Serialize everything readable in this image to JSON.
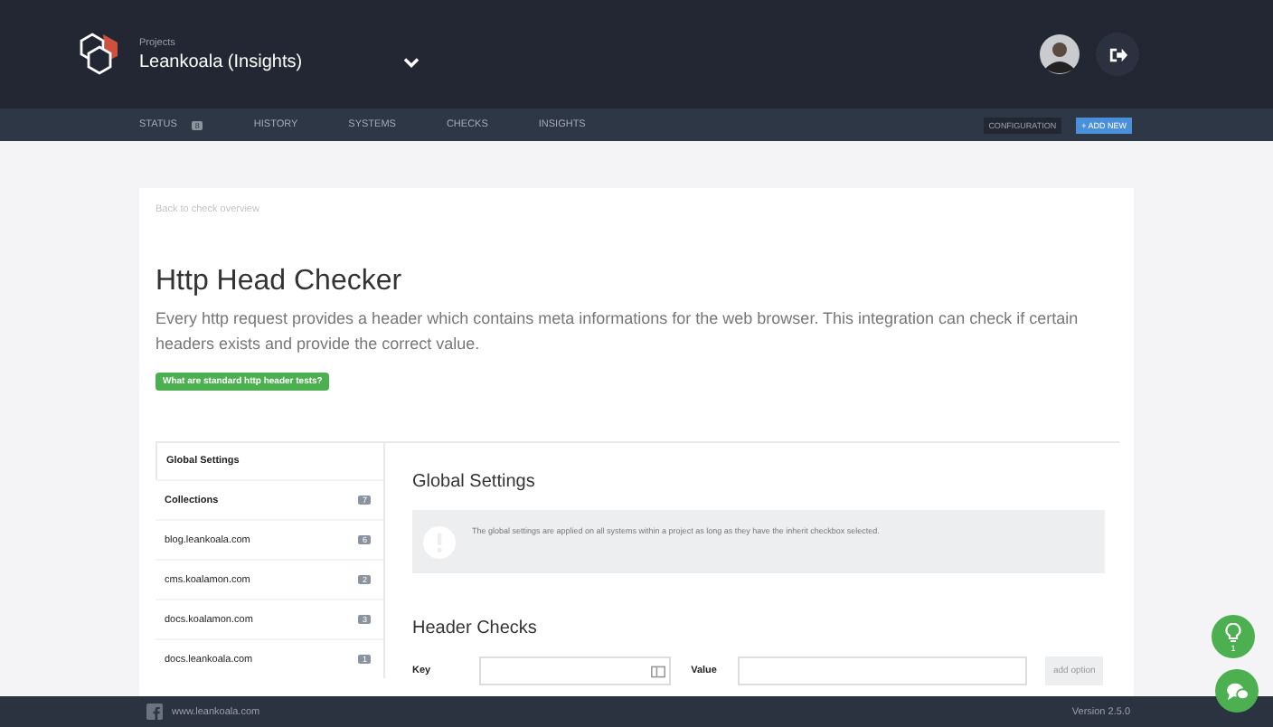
{
  "header": {
    "project_label": "Projects",
    "project_name": "Leankoala (Insights)"
  },
  "nav": {
    "items": [
      {
        "label": "STATUS",
        "badge": "8",
        "selected": false
      },
      {
        "label": "HISTORY",
        "selected": false
      },
      {
        "label": "SYSTEMS",
        "selected": false
      },
      {
        "label": "CHECKS",
        "selected": false
      },
      {
        "label": "INSIGHTS",
        "selected": false
      }
    ],
    "configuration": "CONFIGURATION",
    "add_new": "+ ADD NEW"
  },
  "back_link": "Back to check overview",
  "title": "Http Head Checker",
  "description": "Every http request provides a header which contains meta informations for the web browser. This integration can check if certain headers exists and provide the correct value.",
  "help_button": "What are standard http header tests?",
  "sidebar": {
    "tab": "Global Settings",
    "items": [
      {
        "label": "Collections",
        "badge": "7",
        "kind": "group"
      },
      {
        "label": "blog.leankoala.com",
        "badge": "6",
        "kind": "system"
      },
      {
        "label": "cms.koalamon.com",
        "badge": "2",
        "kind": "system"
      },
      {
        "label": "docs.koalamon.com",
        "badge": "3",
        "kind": "system"
      },
      {
        "label": "docs.leankoala.com",
        "badge": "1",
        "kind": "system"
      }
    ]
  },
  "settings": {
    "heading": "Global Settings",
    "notice": "The global settings are applied on all systems within a project as long as they have the inherit checkbox selected."
  },
  "header_checks": {
    "heading": "Header Checks",
    "key_label": "Key",
    "value_label": "Value",
    "add_button": "add option"
  },
  "tips": {
    "count": "1"
  },
  "footer": {
    "url": "www.leankoala.com",
    "version": "Version 2.5.0"
  }
}
